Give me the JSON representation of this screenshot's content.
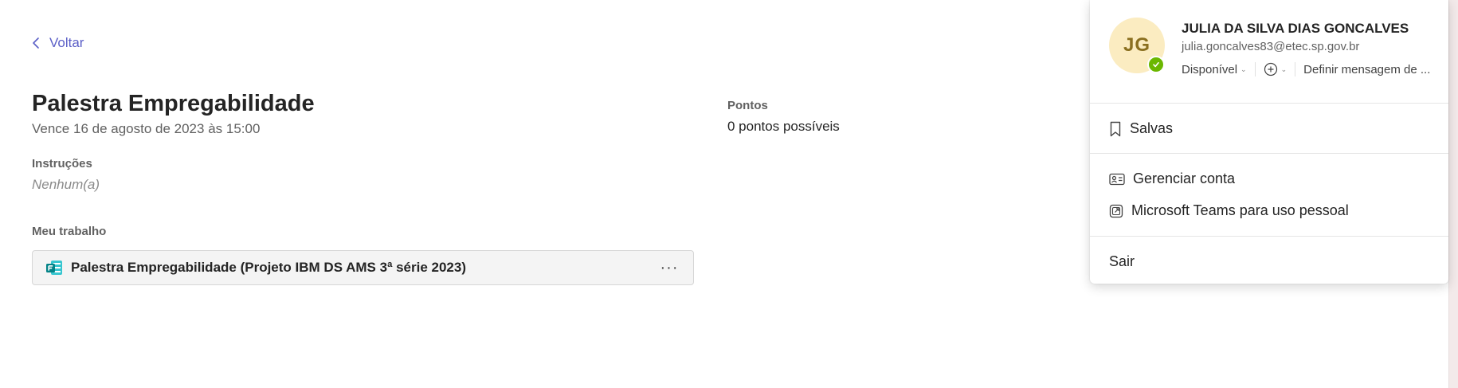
{
  "nav": {
    "back_label": "Voltar"
  },
  "assignment": {
    "title": "Palestra Empregabilidade",
    "due": "Vence 16 de agosto de 2023 às 15:00",
    "instructions_label": "Instruções",
    "instructions_value": "Nenhum(a)",
    "my_work_label": "Meu trabalho",
    "points_label": "Pontos",
    "points_value": "0 pontos possíveis",
    "work_item": {
      "name": "Palestra Empregabilidade (Projeto IBM DS AMS 3ª série 2023)",
      "icon": "forms-icon",
      "more": "···"
    }
  },
  "profile": {
    "initials": "JG",
    "name": "JULIA DA SILVA DIAS GONCALVES",
    "email": "julia.goncalves83@etec.sp.gov.br",
    "status": "Disponível",
    "status_color": "#6bb700",
    "status_message": "Definir mensagem de ...",
    "menu": {
      "saved": "Salvas",
      "manage_account": "Gerenciar conta",
      "teams_personal": "Microsoft Teams para uso pessoal",
      "sign_out": "Sair"
    }
  },
  "colors": {
    "accent": "#5b5fc7",
    "avatar_bg": "#fbecc1",
    "avatar_text": "#8a6f1f",
    "forms": "#038387"
  }
}
